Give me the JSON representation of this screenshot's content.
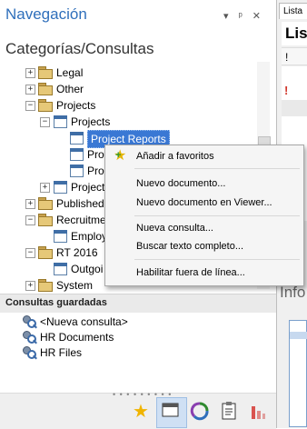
{
  "nav": {
    "title": "Navegación",
    "window_buttons": "▾ ᵖ ✕",
    "subtitle": "Categorías/Consultas"
  },
  "tree": [
    {
      "label": "Legal",
      "icon": "folder-icon",
      "expander": "+",
      "selected": false
    },
    {
      "label": "Other",
      "icon": "folder-icon",
      "expander": "+",
      "selected": false
    },
    {
      "label": "Projects",
      "icon": "folder-icon",
      "expander": "−",
      "selected": false
    },
    {
      "label": "Projects",
      "icon": "document-icon",
      "expander": "−",
      "selected": false
    },
    {
      "label": "Project Reports",
      "icon": "document-icon",
      "expander": "",
      "selected": true
    },
    {
      "label": "Pro",
      "icon": "document-icon",
      "expander": "",
      "selected": false
    },
    {
      "label": "Pro",
      "icon": "document-icon",
      "expander": "",
      "selected": false
    },
    {
      "label": "Project",
      "icon": "document-icon",
      "expander": "+",
      "selected": false
    },
    {
      "label": "Published",
      "icon": "folder-icon",
      "expander": "+",
      "selected": false
    },
    {
      "label": "Recruitmen",
      "icon": "folder-icon",
      "expander": "−",
      "selected": false
    },
    {
      "label": "Employ",
      "icon": "document-icon",
      "expander": "",
      "selected": false
    },
    {
      "label": "RT 2016",
      "icon": "folder-icon",
      "expander": "−",
      "selected": false
    },
    {
      "label": "Outgoi",
      "icon": "document-icon",
      "expander": "",
      "selected": false
    },
    {
      "label": "System",
      "icon": "folder-icon",
      "expander": "+",
      "selected": false
    }
  ],
  "saved_queries": {
    "title": "Consultas guardadas",
    "items": [
      "<Nueva consulta>",
      "HR Documents",
      "HR Files"
    ]
  },
  "context_menu": {
    "items": [
      "Añadir a favoritos",
      "Nuevo documento...",
      "Nuevo documento en Viewer...",
      "Nueva consulta...",
      "Buscar texto completo...",
      "Habilitar fuera de línea..."
    ]
  },
  "toolbar": {
    "grip": "• • • • • • • • •",
    "icons": [
      "star-icon",
      "folder-view-icon",
      "sync-icon",
      "clipboard-icon",
      "chart-icon"
    ]
  },
  "right_panel": {
    "tab_label": "Lista",
    "header": "Lis",
    "column_glyph": "!",
    "flag_glyph": "!",
    "info_label": "Info"
  }
}
